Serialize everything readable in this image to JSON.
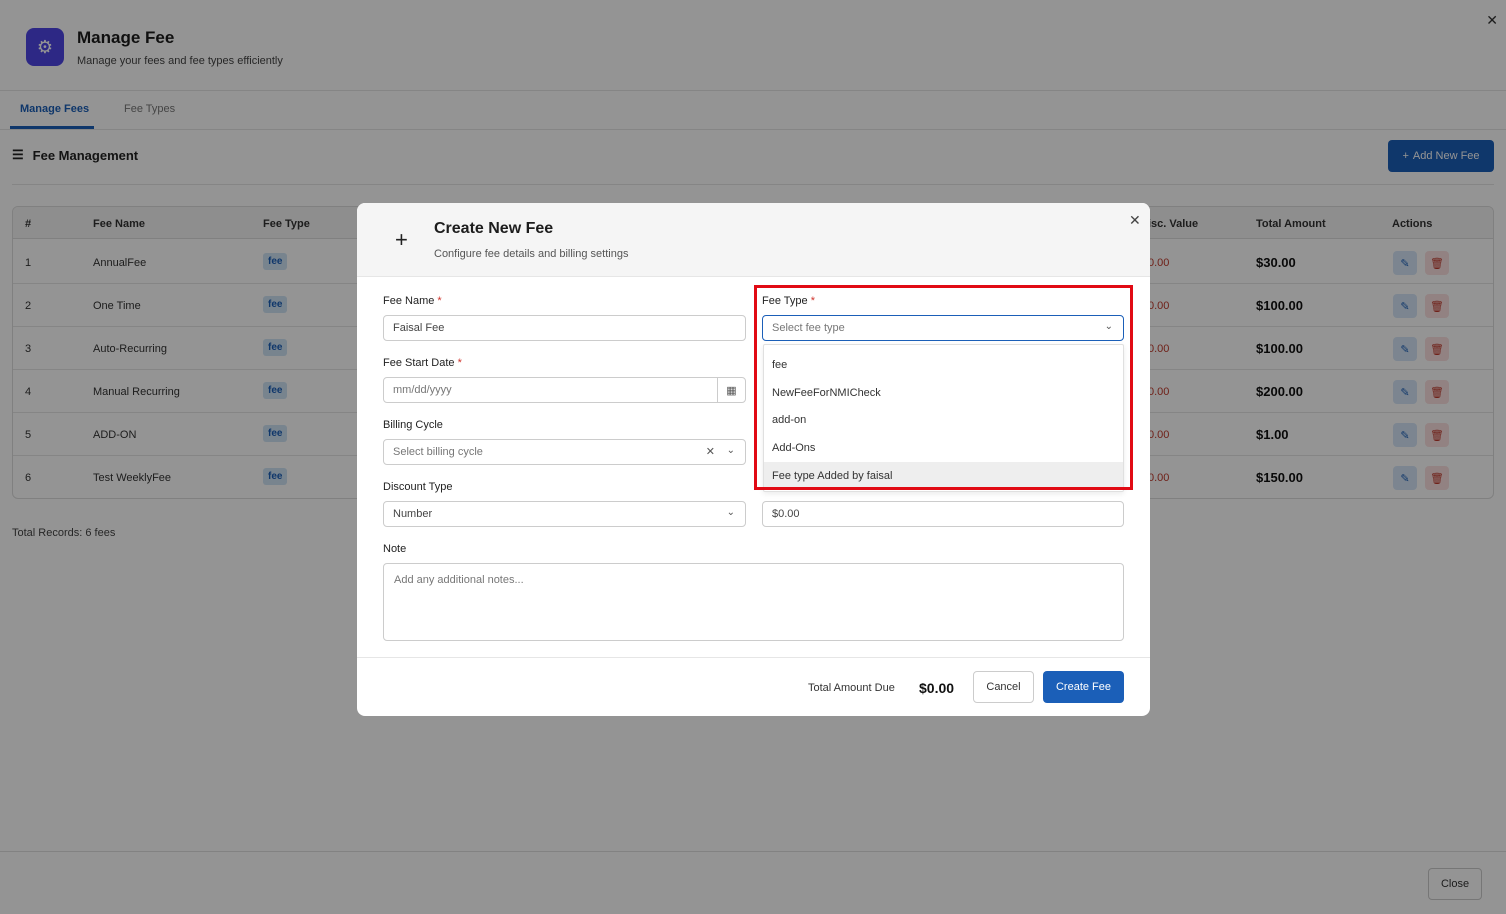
{
  "app": {
    "title": "Manage Fee",
    "subtitle": "Manage your fees and fee types efficiently",
    "close_glyph": "✕",
    "logo_icon": "gear-icon",
    "logo_glyph": "⚙"
  },
  "tabs": [
    {
      "label": "Manage Fees",
      "active": true
    },
    {
      "label": "Fee Types",
      "active": false
    }
  ],
  "section": {
    "title": "Fee Management",
    "icon": "list-icon",
    "icon_glyph": "☰",
    "add_button": "Add New Fee",
    "add_glyph": "+"
  },
  "table": {
    "headers": {
      "num": "#",
      "fee_name": "Fee Name",
      "fee_type": "Fee Type",
      "disc_value": "isc. Value",
      "total_amount": "Total Amount",
      "actions": "Actions"
    },
    "rows": [
      {
        "num": "1",
        "fee_name": "AnnualFee",
        "fee_type": "fee",
        "disc": "0.00",
        "total": "$30.00"
      },
      {
        "num": "2",
        "fee_name": "One Time",
        "fee_type": "fee",
        "disc": "0.00",
        "total": "$100.00"
      },
      {
        "num": "3",
        "fee_name": "Auto-Recurring",
        "fee_type": "fee",
        "disc": "0.00",
        "total": "$100.00"
      },
      {
        "num": "4",
        "fee_name": "Manual Recurring",
        "fee_type": "fee",
        "disc": "0.00",
        "total": "$200.00"
      },
      {
        "num": "5",
        "fee_name": "ADD-ON",
        "fee_type": "fee",
        "disc": "0.00",
        "total": "$1.00"
      },
      {
        "num": "6",
        "fee_name": "Test WeeklyFee",
        "fee_type": "fee",
        "disc": "0.00",
        "total": "$150.00"
      }
    ],
    "edit_glyph": "✎",
    "delete_glyph": "🗑"
  },
  "total_records": "Total Records: 6 fees",
  "footer": {
    "close_button": "Close"
  },
  "modal": {
    "title": "Create New Fee",
    "subtitle": "Configure fee details and billing settings",
    "plus_glyph": "+",
    "close_glyph": "✕",
    "fee_name": {
      "label": "Fee Name",
      "required": "*",
      "value": "Faisal Fee"
    },
    "fee_type": {
      "label": "Fee Type",
      "required": "*",
      "placeholder": "Select fee type"
    },
    "fee_start_date": {
      "label": "Fee Start Date",
      "required": "*",
      "placeholder": "mm/dd/yyyy"
    },
    "billing_cycle": {
      "label": "Billing Cycle",
      "placeholder": "Select billing cycle"
    },
    "discount_type": {
      "label": "Discount Type",
      "value": "Number"
    },
    "discount": {
      "value": "$0.00"
    },
    "note": {
      "label": "Note",
      "placeholder": "Add any additional notes..."
    },
    "fee_type_options": [
      "fee",
      "NewFeeForNMICheck",
      "add-on",
      "Add-Ons",
      "Fee type Added by faisal"
    ],
    "total_amount_due_label": "Total Amount Due",
    "total_amount_due_value": "$0.00",
    "cancel_button": "Cancel",
    "create_button": "Create Fee",
    "highlight_color": "#e10a14",
    "accent_color": "#1b5fb8"
  }
}
